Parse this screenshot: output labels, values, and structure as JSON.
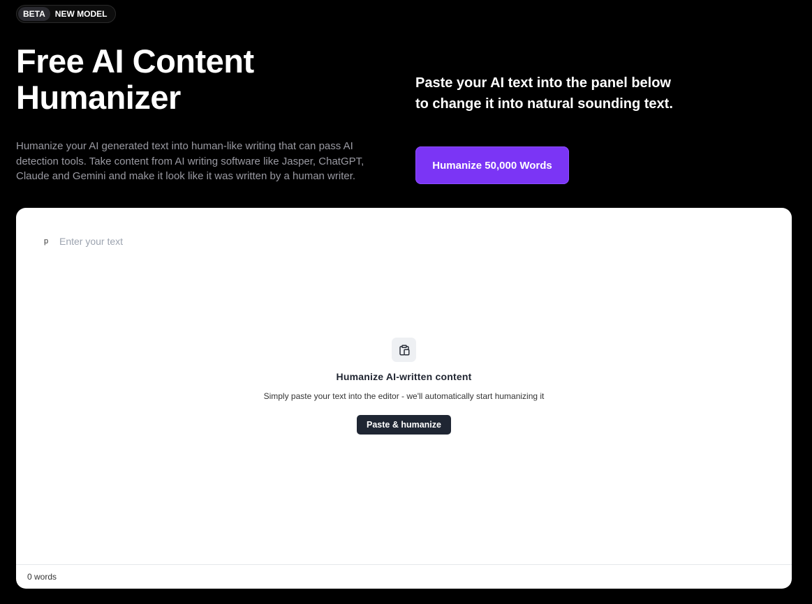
{
  "badge": {
    "beta": "BETA",
    "new_model": "NEW MODEL"
  },
  "hero": {
    "title_line1": "Free AI Content",
    "title_line2": "Humanizer",
    "description": "Humanize your AI generated text into human-like writing that can pass AI detection tools. Take content from AI writing software like Jasper, ChatGPT, Claude and Gemini and make it look like it was written by a human writer."
  },
  "cta": {
    "text_line1": "Paste your AI text into the panel below",
    "text_line2": "to change it into natural sounding text.",
    "button_label": "Humanize 50,000 Words",
    "accent_color": "#7b35f5"
  },
  "editor": {
    "paragraph_tag": "p",
    "placeholder": "Enter your text",
    "empty_state": {
      "icon": "clipboard-icon",
      "title": "Humanize AI-written content",
      "subtitle": "Simply paste your text into the editor - we'll automatically start humanizing it",
      "button_label": "Paste & humanize"
    },
    "word_count": "0 words"
  }
}
